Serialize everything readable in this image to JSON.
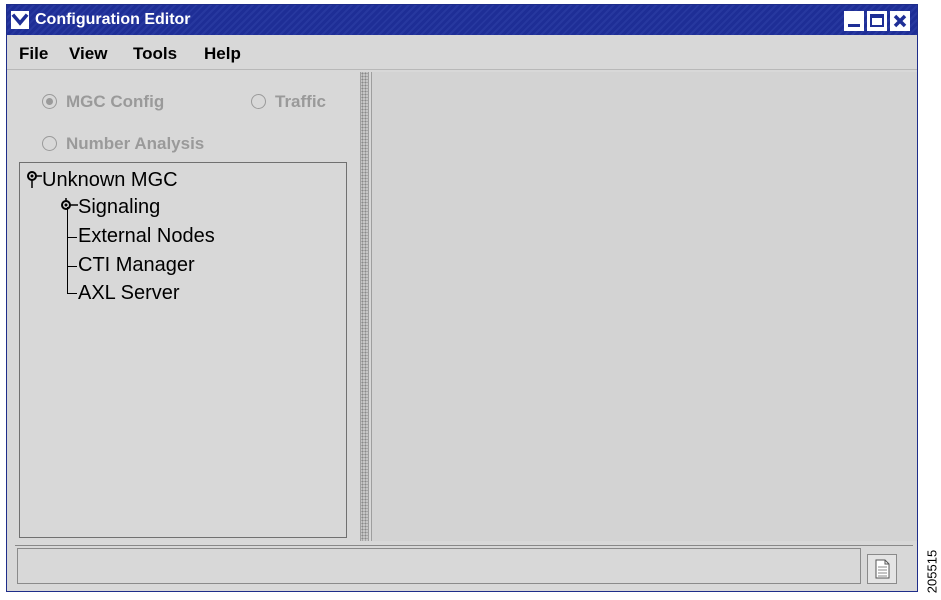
{
  "window": {
    "title": "Configuration Editor"
  },
  "titlebar": {
    "menu_icon": "chevron-down-icon",
    "minimize_icon": "minimize-icon",
    "maximize_icon": "maximize-icon",
    "close_icon": "close-icon",
    "color": "#1e2e96"
  },
  "menubar": {
    "items": [
      "File",
      "View",
      "Tools",
      "Help"
    ]
  },
  "modes": {
    "options": [
      {
        "label": "MGC Config",
        "selected": true
      },
      {
        "label": "Traffic",
        "selected": false
      },
      {
        "label": "Number Analysis",
        "selected": false
      }
    ]
  },
  "tree": {
    "root": {
      "label": "Unknown MGC",
      "icon": "key-node-icon"
    },
    "children": [
      {
        "label": "Signaling",
        "icon": "key-node-icon"
      },
      {
        "label": "External Nodes"
      },
      {
        "label": "CTI Manager"
      },
      {
        "label": "AXL Server"
      }
    ]
  },
  "statusbar": {
    "text": "",
    "icon": "document-icon"
  },
  "figure_id": "205515"
}
